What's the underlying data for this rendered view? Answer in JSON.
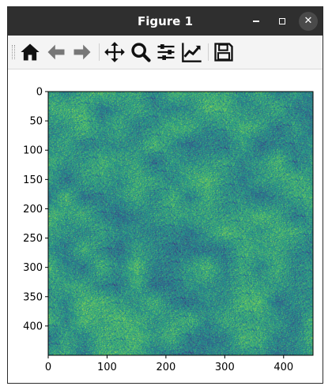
{
  "window": {
    "title": "Figure 1",
    "buttons": {
      "minimize": "minimize",
      "maximize": "maximize",
      "close": "close"
    }
  },
  "toolbar": {
    "items": [
      {
        "name": "home-icon",
        "label": "Home"
      },
      {
        "name": "back-icon",
        "label": "Back"
      },
      {
        "name": "forward-icon",
        "label": "Forward"
      },
      {
        "name": "pan-icon",
        "label": "Pan"
      },
      {
        "name": "zoom-icon",
        "label": "Zoom"
      },
      {
        "name": "subplots-icon",
        "label": "Subplots"
      },
      {
        "name": "customize-icon",
        "label": "Customize"
      },
      {
        "name": "save-icon",
        "label": "Save"
      }
    ]
  },
  "chart_data": {
    "type": "heatmap",
    "title": "",
    "xlabel": "",
    "ylabel": "",
    "rows": 450,
    "cols": 450,
    "xlim": [
      0,
      450
    ],
    "ylim": [
      450,
      0
    ],
    "xticks": [
      "0",
      "100",
      "200",
      "300",
      "400"
    ],
    "yticks": [
      "0",
      "50",
      "100",
      "150",
      "200",
      "250",
      "300",
      "350",
      "400"
    ],
    "colormap": "viridis",
    "colors": [
      "#440154",
      "#3b528b",
      "#21918c",
      "#5ec962",
      "#fde725"
    ],
    "values": "random noise field"
  }
}
